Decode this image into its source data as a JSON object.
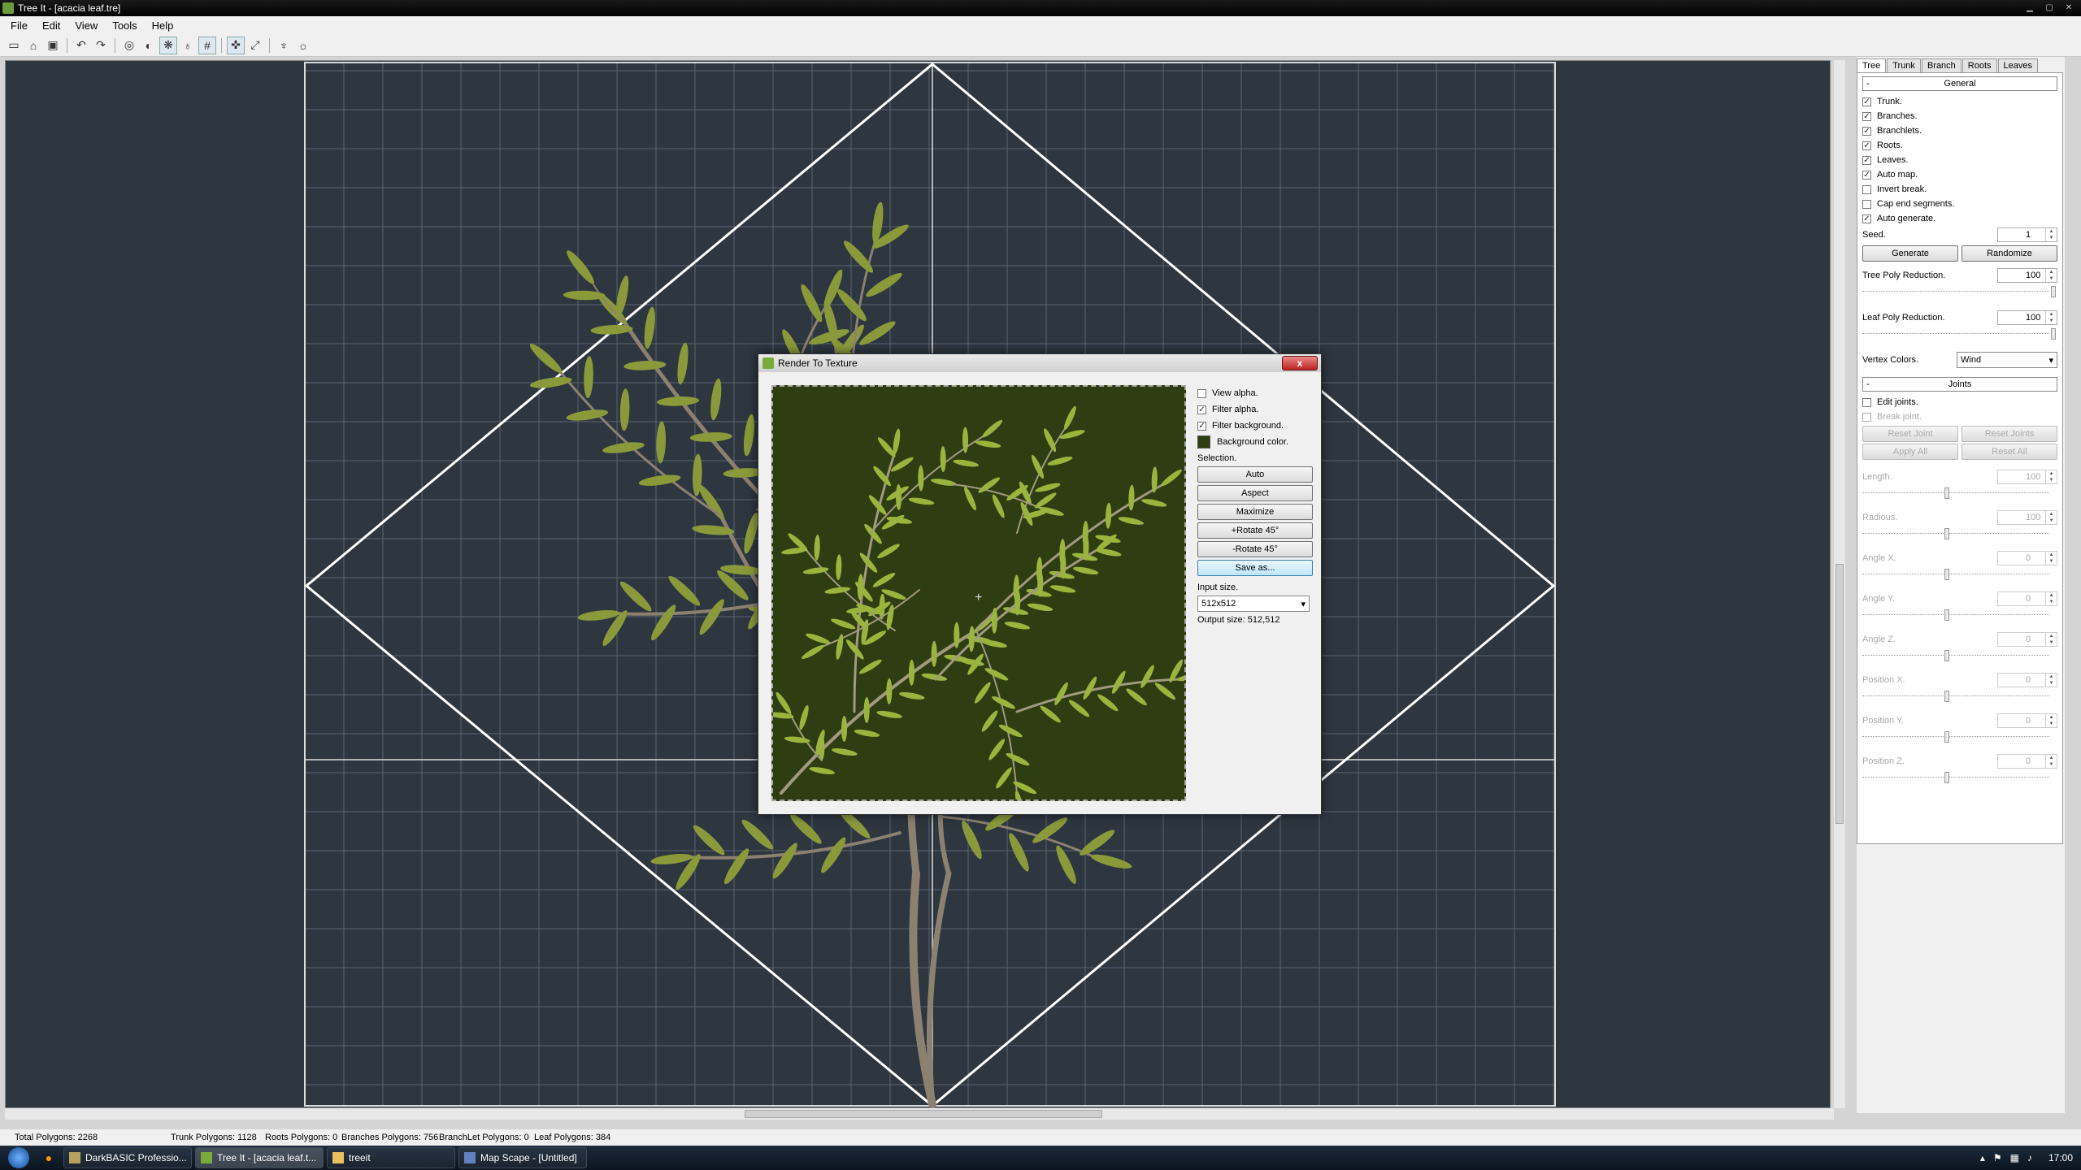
{
  "window": {
    "title": "Tree It - [acacia leaf.tre]"
  },
  "menu": [
    "File",
    "Edit",
    "View",
    "Tools",
    "Help"
  ],
  "toolbar": {
    "icons": [
      "new-icon",
      "open-icon",
      "save-icon",
      "undo-icon",
      "redo-icon",
      "wireframe-icon",
      "texture-icon",
      "leaf-mode-icon",
      "light-icon",
      "grid-icon",
      "axis-icon",
      "fit-icon",
      "wind-icon",
      "sun-icon"
    ]
  },
  "panel": {
    "tabs": [
      "Tree",
      "Trunk",
      "Branch",
      "Roots",
      "Leaves"
    ],
    "general": {
      "header": "General",
      "collapse": "-",
      "checks": [
        {
          "label": "Trunk.",
          "checked": true
        },
        {
          "label": "Branches.",
          "checked": true
        },
        {
          "label": "Branchlets.",
          "checked": true
        },
        {
          "label": "Roots.",
          "checked": true
        },
        {
          "label": "Leaves.",
          "checked": true
        },
        {
          "label": "Auto map.",
          "checked": true
        },
        {
          "label": "Invert break.",
          "checked": false
        },
        {
          "label": "Cap end segments.",
          "checked": false
        },
        {
          "label": "Auto generate.",
          "checked": true
        }
      ],
      "seed_label": "Seed.",
      "seed_value": "1",
      "generate": "Generate",
      "randomize": "Randomize",
      "tree_poly_label": "Tree Poly Reduction.",
      "tree_poly_value": "100",
      "leaf_poly_label": "Leaf Poly Reduction.",
      "leaf_poly_value": "100",
      "vertex_label": "Vertex Colors.",
      "vertex_value": "Wind"
    },
    "joints": {
      "header": "Joints",
      "collapse": "-",
      "edit": "Edit joints.",
      "break": "Break joint.",
      "reset_joint": "Reset Joint",
      "reset_joints": "Reset Joints",
      "apply_all": "Apply All",
      "reset_all": "Reset All",
      "fields": [
        {
          "label": "Length.",
          "value": "100"
        },
        {
          "label": "Radious.",
          "value": "100"
        },
        {
          "label": "Angle X.",
          "value": "0"
        },
        {
          "label": "Angle Y.",
          "value": "0"
        },
        {
          "label": "Angle Z.",
          "value": "0"
        },
        {
          "label": "Position X.",
          "value": "0"
        },
        {
          "label": "Position Y.",
          "value": "0"
        },
        {
          "label": "Position Z.",
          "value": "0"
        }
      ]
    }
  },
  "dialog": {
    "title": "Render To Texture",
    "close": "x",
    "view_alpha": "View alpha.",
    "filter_alpha": "Filter alpha.",
    "filter_bg": "Filter background.",
    "bg_color": "Background color.",
    "selection": "Selection.",
    "auto": "Auto",
    "aspect": "Aspect",
    "maximize": "Maximize",
    "rot_plus": "+Rotate 45°",
    "rot_minus": "-Rotate 45°",
    "save_as": "Save as...",
    "input_size_label": "Input size.",
    "input_size": "512x512",
    "output_size": "Output size: 512,512",
    "bg_hex": "#2f3d12"
  },
  "status": {
    "total": "Total Polygons: 2268",
    "trunk": "Trunk Polygons: 1128",
    "roots": "Roots Polygons: 0",
    "branches": "Branches Polygons: 756",
    "branchlet": "BranchLet Polygons: 0",
    "leaf": "Leaf Polygons: 384"
  },
  "taskbar": {
    "tasks": [
      "DarkBASIC Professio...",
      "Tree It - [acacia leaf.t...",
      "treeit",
      "Map Scape - [Untitled]"
    ],
    "clock": "17:00"
  },
  "colors": {
    "viewport_bg": "#2e3640",
    "leaf": "#8a9a3a"
  }
}
